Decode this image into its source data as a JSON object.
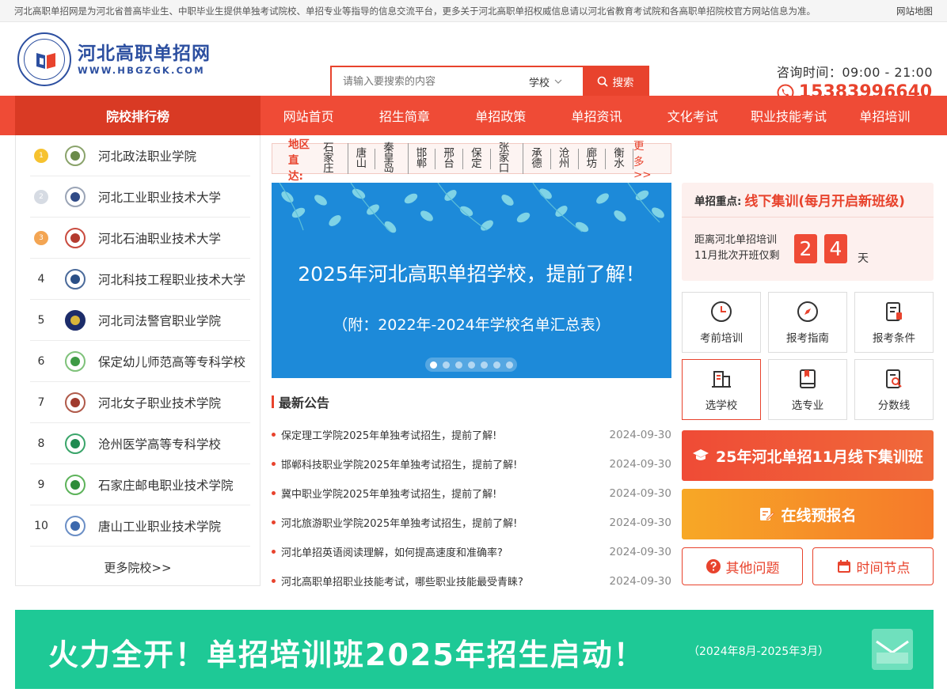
{
  "topbar": {
    "notice": "河北高职单招网是为河北省普高毕业生、中职毕业生提供单独考试院校、单招专业等指导的信息交流平台，更多关于河北高职单招权威信息请以河北省教育考试院和各高职单招院校官方网站信息为准。",
    "sitemap": "网站地图"
  },
  "header": {
    "logo_cn": "河北高职单招网",
    "logo_en": "WWW.HBGZGK.COM",
    "search_placeholder": "请输入要搜索的内容",
    "search_scope": "学校",
    "search_button": "搜索",
    "hours": "咨询时间：09:00 - 21:00",
    "phone": "15383996640"
  },
  "nav": {
    "rank_label": "院校排行榜",
    "items": [
      "网站首页",
      "招生简章",
      "单招政策",
      "单招资讯",
      "文化考试",
      "职业技能考试",
      "单招培训"
    ]
  },
  "ranking": {
    "schools": [
      {
        "rank": "1",
        "name": "河北政法职业学院"
      },
      {
        "rank": "2",
        "name": "河北工业职业技术大学"
      },
      {
        "rank": "3",
        "name": "河北石油职业技术大学"
      },
      {
        "rank": "4",
        "name": "河北科技工程职业技术大学"
      },
      {
        "rank": "5",
        "name": "河北司法警官职业学院"
      },
      {
        "rank": "6",
        "name": "保定幼儿师范高等专科学校"
      },
      {
        "rank": "7",
        "name": "河北女子职业技术学院"
      },
      {
        "rank": "8",
        "name": "沧州医学高等专科学校"
      },
      {
        "rank": "9",
        "name": "石家庄邮电职业技术学院"
      },
      {
        "rank": "10",
        "name": "唐山工业职业技术学院"
      }
    ],
    "more": "更多院校>>"
  },
  "region": {
    "label": "地区直达:",
    "cities": [
      "石家庄",
      "唐山",
      "秦皇岛",
      "邯郸",
      "邢台",
      "保定",
      "张家口",
      "承德",
      "沧州",
      "廊坊",
      "衡水"
    ],
    "more": "更多>>"
  },
  "banner": {
    "title": "2025年河北高职单招学校，提前了解！",
    "subtitle": "（附：2022年-2024年学校名单汇总表）"
  },
  "notices": {
    "heading": "最新公告",
    "items": [
      {
        "title": "保定理工学院2025年单独考试招生，提前了解!",
        "date": "2024-09-30"
      },
      {
        "title": "邯郸科技职业学院2025年单独考试招生，提前了解!",
        "date": "2024-09-30"
      },
      {
        "title": "冀中职业学院2025年单独考试招生，提前了解!",
        "date": "2024-09-30"
      },
      {
        "title": "河北旅游职业学院2025年单独考试招生，提前了解!",
        "date": "2024-09-30"
      },
      {
        "title": "河北单招英语阅读理解，如何提高速度和准确率?",
        "date": "2024-09-30"
      },
      {
        "title": "河北高职单招职业技能考试，哪些职业技能最受青睐?",
        "date": "2024-09-30"
      }
    ]
  },
  "focus": {
    "key": "单招重点:",
    "value": "线下集训(每月开启新班级)",
    "line1": "距离河北单招培训",
    "line2": "11月批次开班仅剩",
    "digit1": "2",
    "digit2": "4",
    "unit": "天"
  },
  "quick": [
    "考前培训",
    "报考指南",
    "报考条件",
    "选学校",
    "选专业",
    "分数线"
  ],
  "cta": {
    "train": "25年河北单招11月线下集训班",
    "apply": "在线预报名",
    "faq": "其他问题",
    "timeline": "时间节点"
  },
  "footer_banner": {
    "title": "火力全开！单招培训班2025年招生启动！",
    "period": "（2024年8月-2025年3月）"
  },
  "colors": {
    "accent": "#e8432d",
    "nav": "#ef4b36",
    "banner": "#1d8ad9",
    "footer": "#1ec996"
  }
}
